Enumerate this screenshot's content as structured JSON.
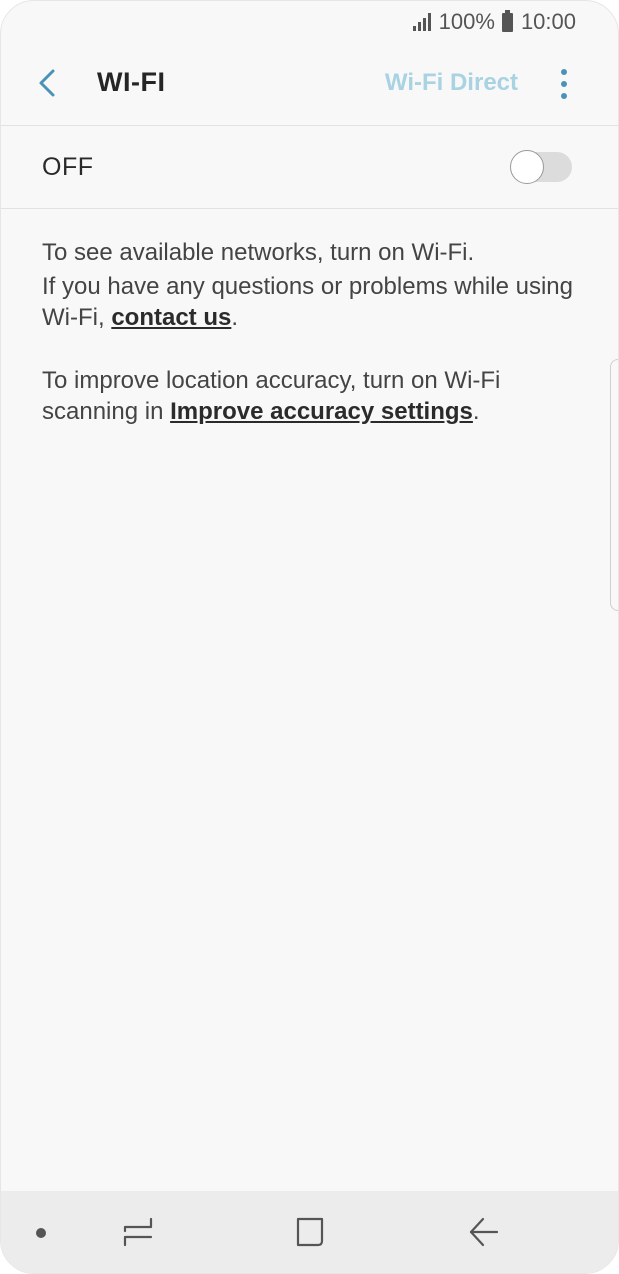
{
  "status_bar": {
    "battery": "100%",
    "time": "10:00"
  },
  "header": {
    "title": "WI-FI",
    "wifi_direct": "Wi-Fi Direct",
    "accent_color": "#4a92b8",
    "disabled_color": "#a9d2e2"
  },
  "toggle_row": {
    "label": "OFF",
    "state": "off"
  },
  "content": {
    "line1": "To see available networks, turn on Wi-Fi.",
    "line2_prefix": "If you have any questions or problems while using Wi-Fi, ",
    "contact_link": "contact us",
    "line2_suffix": ".",
    "line3_prefix": "To improve location accuracy, turn on Wi-Fi scanning in ",
    "accuracy_link": "Improve accuracy settings",
    "line3_suffix": "."
  },
  "nav_bar": {
    "icons": [
      "dot-icon",
      "recents-icon",
      "home-icon",
      "back-icon"
    ]
  }
}
